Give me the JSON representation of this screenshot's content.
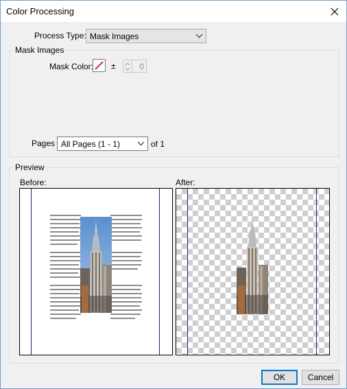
{
  "window": {
    "title": "Color Processing"
  },
  "process_type": {
    "label": "Process Type:",
    "value": "Mask Images"
  },
  "mask_group": {
    "title": "Mask Images",
    "mask_color_label": "Mask Color:",
    "plus_minus": "±",
    "tolerance_value": "0"
  },
  "pages": {
    "label": "Pages",
    "value": "All Pages (1 - 1)",
    "of_text": "of 1"
  },
  "preview": {
    "title": "Preview",
    "before_label": "Before:",
    "after_label": "After:"
  },
  "buttons": {
    "ok": "OK",
    "cancel": "Cancel"
  },
  "icons": {
    "close": "close-icon",
    "chevron": "chevron-down-icon",
    "mask_color": "slash-swatch-icon"
  },
  "colors": {
    "page_border": "#1c1ca0",
    "mask_slash": "#e00000",
    "default_button_border": "#0078d7"
  }
}
